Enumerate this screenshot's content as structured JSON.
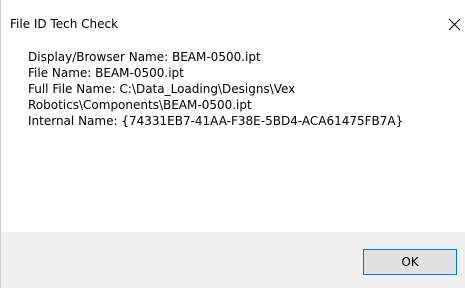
{
  "window": {
    "title": "File ID Tech Check",
    "close_icon": "close-icon"
  },
  "message": {
    "lines": [
      "Display/Browser Name: BEAM-0500.ipt",
      "File Name: BEAM-0500.ipt",
      "Full File Name: C:\\Data_Loading\\Designs\\Vex",
      "Robotics\\Components\\BEAM-0500.ipt",
      "Internal Name: {74331EB7-41AA-F38E-5BD4-ACA61475FB7A}"
    ]
  },
  "footer": {
    "ok_label": "OK"
  },
  "colors": {
    "footer_bg": "#f0f0f0",
    "button_border": "#0078d7",
    "button_bg": "#e1e1e1"
  }
}
